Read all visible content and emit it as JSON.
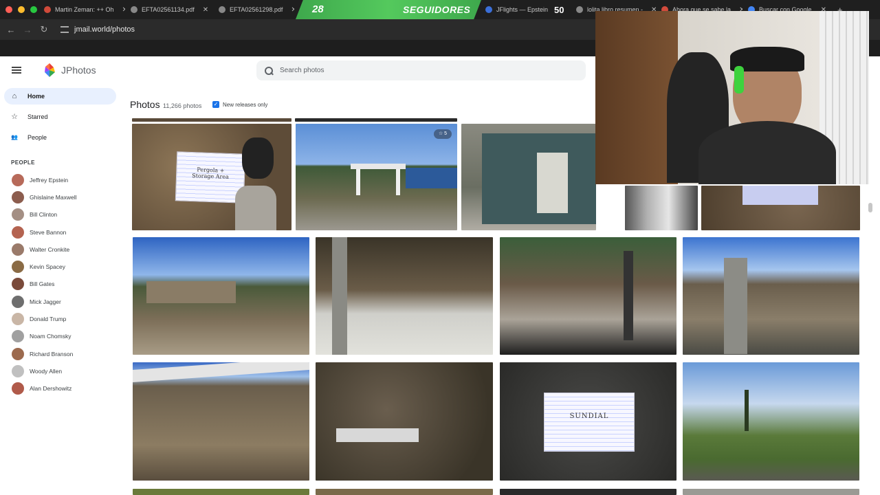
{
  "browser": {
    "tabs": [
      {
        "label": "Martin Zeman: ++ Oh"
      },
      {
        "label": "EFTA02561134.pdf"
      },
      {
        "label": "EFTA02561298.pdf"
      },
      {
        "label": "JFlights — Epstein Fl"
      },
      {
        "label": "lolita libro resumen -"
      },
      {
        "label": "Ahora que se sabe la"
      },
      {
        "label": "Buscar con Google"
      }
    ],
    "new_tab_glyph": "+",
    "url": "jmail.world/photos",
    "nav": {
      "back": "←",
      "forward": "→",
      "reload": "↻"
    }
  },
  "stream_overlay": {
    "count": "28",
    "label": "SEGUIDORES",
    "badge": "50"
  },
  "app": {
    "name": "JPhotos",
    "search_placeholder": "Search photos"
  },
  "sidebar": {
    "items": [
      {
        "label": "Home",
        "icon": "home-icon",
        "glyph": "⌂"
      },
      {
        "label": "Starred",
        "icon": "star-icon",
        "glyph": "☆"
      },
      {
        "label": "People",
        "icon": "people-icon",
        "glyph": "👥"
      }
    ],
    "section_title": "PEOPLE",
    "people": [
      {
        "name": "Jeffrey Epstein",
        "color": "#b76a5a"
      },
      {
        "name": "Ghislaine Maxwell",
        "color": "#8c5d4e"
      },
      {
        "name": "Bill Clinton",
        "color": "#a48f84"
      },
      {
        "name": "Steve Bannon",
        "color": "#b46350"
      },
      {
        "name": "Walter Cronkite",
        "color": "#9a7a6a"
      },
      {
        "name": "Kevin Spacey",
        "color": "#8a6b45"
      },
      {
        "name": "Bill Gates",
        "color": "#7a4a3a"
      },
      {
        "name": "Mick Jagger",
        "color": "#6e6e6e"
      },
      {
        "name": "Donald Trump",
        "color": "#c9b6a6"
      },
      {
        "name": "Noam Chomsky",
        "color": "#a0a0a0"
      },
      {
        "name": "Richard Branson",
        "color": "#9c6a4e"
      },
      {
        "name": "Woody Allen",
        "color": "#c0c0c0"
      },
      {
        "name": "Alan Dershowitz",
        "color": "#b05a4a"
      }
    ]
  },
  "main": {
    "title": "Photos",
    "count": "11,266 photos",
    "filter_label": "New releases only",
    "filter_checked": true,
    "star_badge": "☆ 5",
    "note_1": "Pergola +\nStorage Area",
    "note_2": "SUNDIAL"
  },
  "colors": {
    "accent": "#1a73e8",
    "active_bg": "#e8f0fe",
    "banner": "#54c95d"
  }
}
